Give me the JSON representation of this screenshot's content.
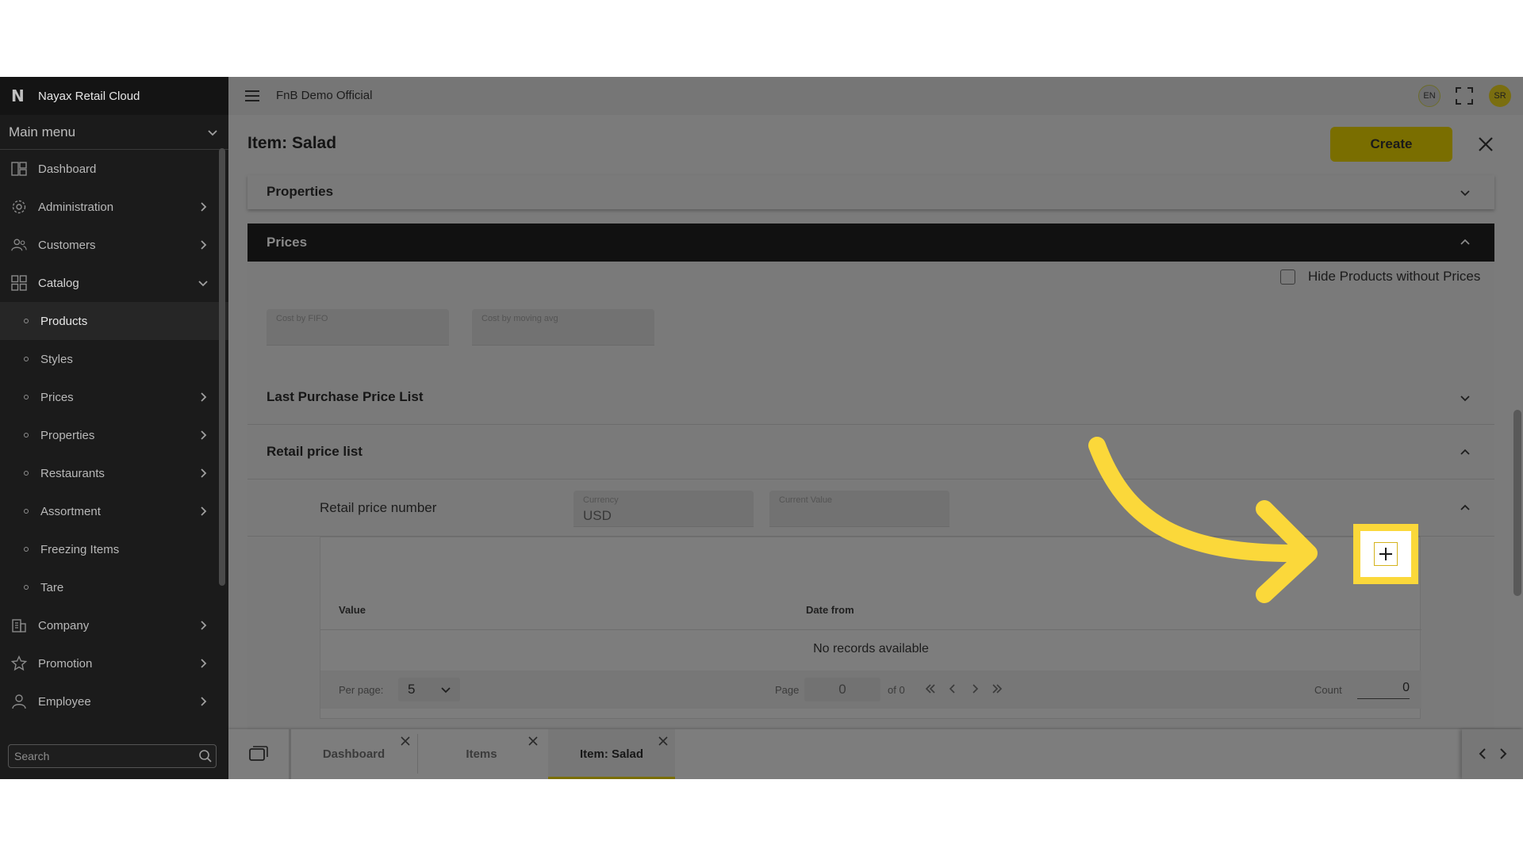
{
  "app": {
    "brand": "Nayax Retail Cloud",
    "main_menu": "Main menu",
    "org": "FnB Demo Official",
    "lang": "EN",
    "user_initials": "SR",
    "search_placeholder": "Search"
  },
  "sidebar": {
    "items": [
      {
        "label": "Dashboard",
        "icon": "dashboard-icon",
        "has_children": false
      },
      {
        "label": "Administration",
        "icon": "admin-gear-icon",
        "has_children": true
      },
      {
        "label": "Customers",
        "icon": "customers-icon",
        "has_children": true
      },
      {
        "label": "Catalog",
        "icon": "catalog-grid-icon",
        "has_children": true,
        "expanded": true
      }
    ],
    "catalog_children": [
      {
        "label": "Products",
        "active": true,
        "has_children": false
      },
      {
        "label": "Styles",
        "has_children": false
      },
      {
        "label": "Prices",
        "has_children": true
      },
      {
        "label": "Properties",
        "has_children": true
      },
      {
        "label": "Restaurants",
        "has_children": true
      },
      {
        "label": "Assortment",
        "has_children": true
      },
      {
        "label": "Freezing Items",
        "has_children": false
      },
      {
        "label": "Tare",
        "has_children": false
      }
    ],
    "bottom_items": [
      {
        "label": "Company",
        "icon": "company-building-icon"
      },
      {
        "label": "Promotion",
        "icon": "promotion-star-icon"
      },
      {
        "label": "Employee",
        "icon": "employee-icon"
      }
    ]
  },
  "page": {
    "title": "Item: Salad",
    "create_label": "Create",
    "properties_label": "Properties",
    "prices_label": "Prices",
    "hide_products_label": "Hide Products without Prices",
    "cost_fifo_label": "Cost by FIFO",
    "cost_avg_label": "Cost by moving avg",
    "last_purchase_label": "Last Purchase Price List",
    "retail_price_list_label": "Retail price list",
    "retail_price_number_label": "Retail price number",
    "currency_label": "Currency",
    "currency_value": "USD",
    "current_value_label": "Current Value",
    "table": {
      "columns": [
        "Value",
        "Date from"
      ],
      "empty_text": "No records available",
      "per_page_label": "Per page:",
      "per_page_value": "5",
      "page_label": "Page",
      "page_value": "0",
      "of_label": "of 0",
      "count_label": "Count",
      "count_value": "0"
    }
  },
  "tabs": [
    {
      "label": "Dashboard",
      "active": false
    },
    {
      "label": "Items",
      "active": false
    },
    {
      "label": "Item: Salad",
      "active": true
    }
  ],
  "colors": {
    "accent": "#7a6e00",
    "tutorial_highlight": "#fbd83a"
  }
}
